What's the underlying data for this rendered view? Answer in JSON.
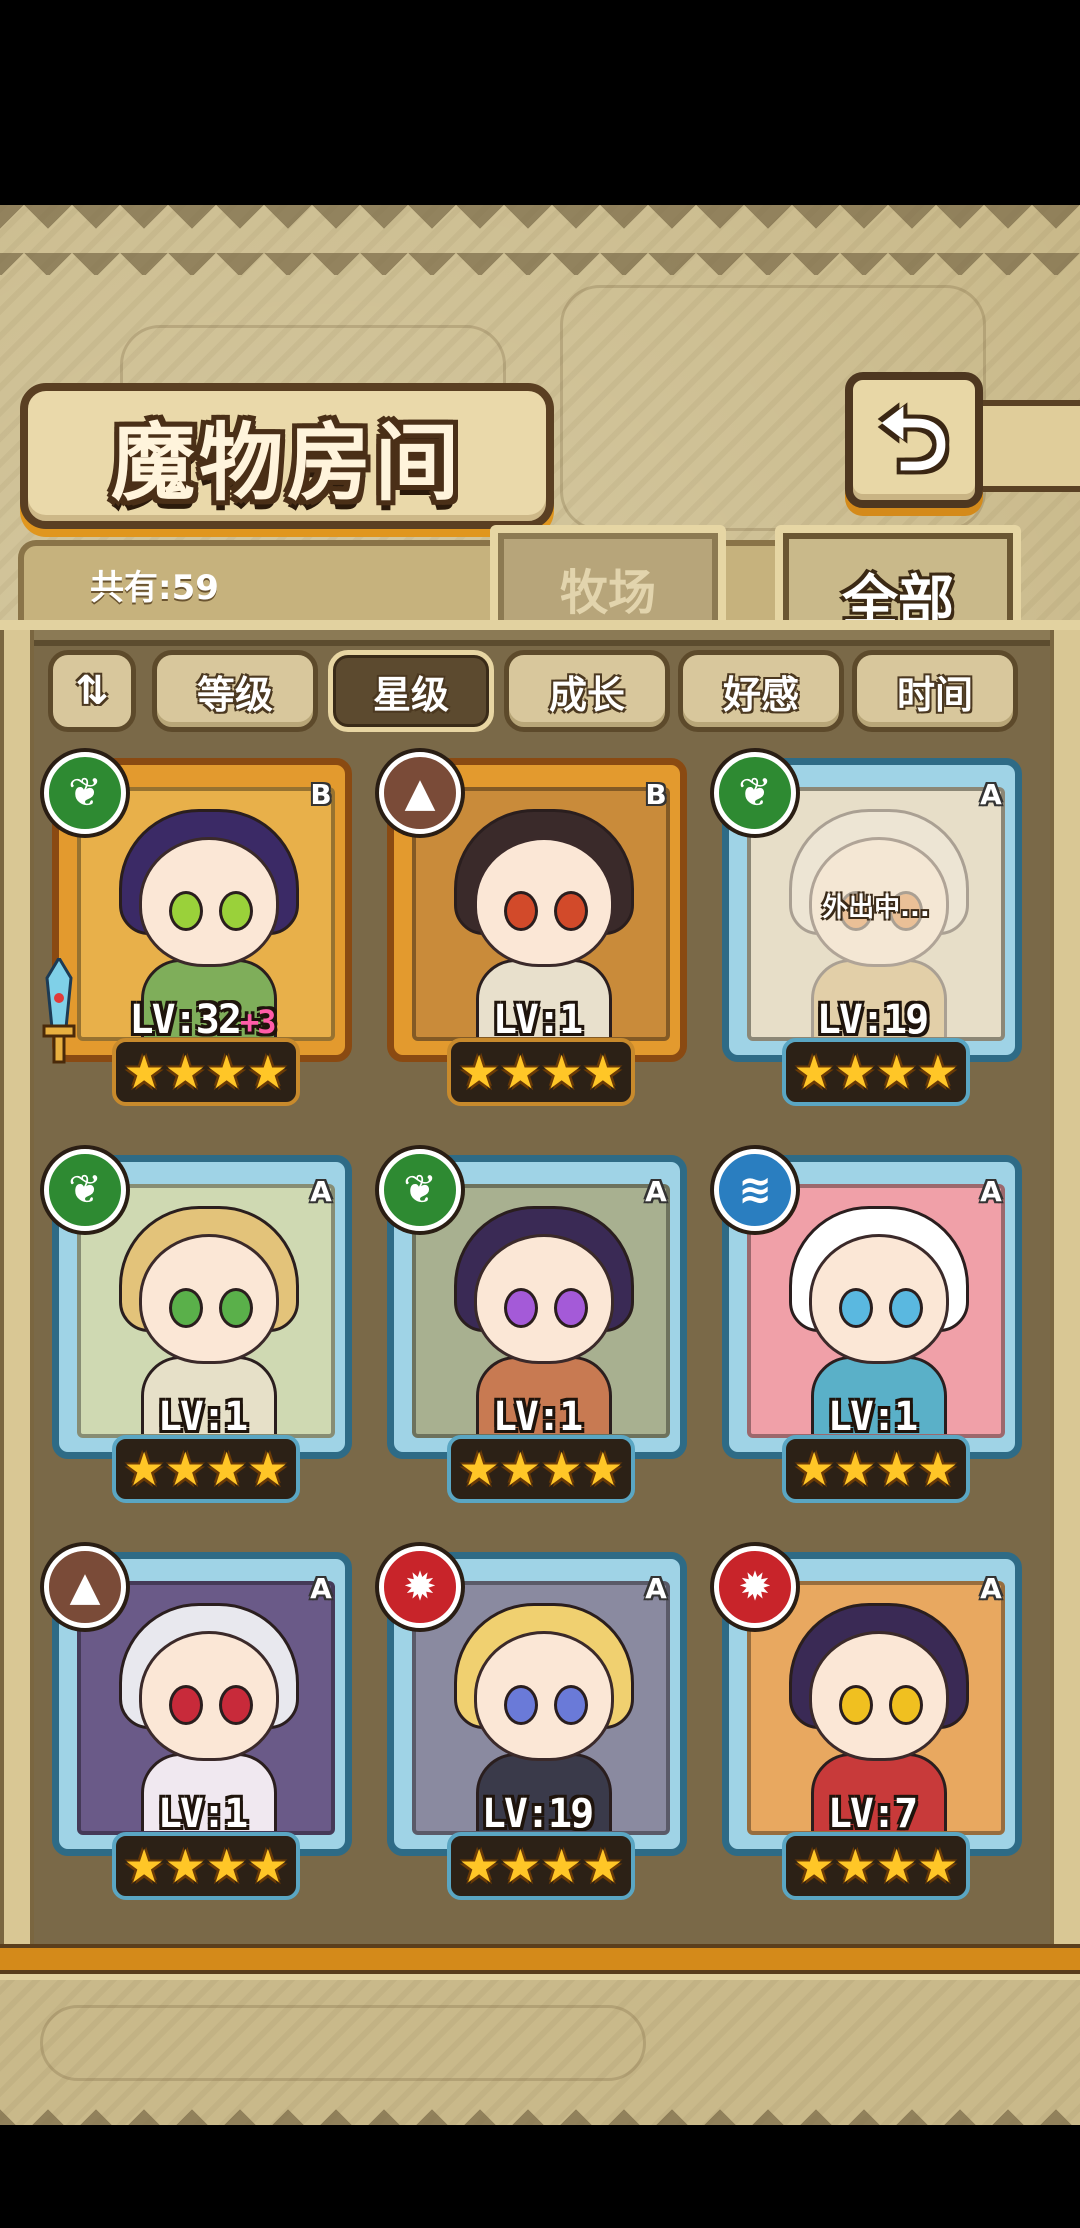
{
  "header": {
    "title": "魔物房间",
    "back_label": "⮌"
  },
  "summary": {
    "count_text": "共有:59"
  },
  "tabs": [
    {
      "label": "牧场",
      "selected": false
    },
    {
      "label": "全部",
      "selected": true
    }
  ],
  "sort": {
    "toggle_label": "⇅",
    "options": [
      {
        "label": "等级",
        "active": false
      },
      {
        "label": "星级",
        "active": true
      },
      {
        "label": "成长",
        "active": false
      },
      {
        "label": "好感",
        "active": false
      },
      {
        "label": "时间",
        "active": false
      }
    ]
  },
  "monsters": [
    {
      "rank": "B",
      "element": "leaf",
      "level": "LV:32",
      "bonus": "+3",
      "stars": 4,
      "status": "",
      "colors": {
        "hair": "#3b2a66",
        "bg": "#e8b04a",
        "body": "#7fae5a",
        "eye": "#9ad13a"
      }
    },
    {
      "rank": "B",
      "element": "rock",
      "level": "LV:1",
      "bonus": "",
      "stars": 4,
      "status": "",
      "colors": {
        "hair": "#3a2a2a",
        "bg": "#c98b3a",
        "body": "#e8e0cc",
        "eye": "#d24a2a"
      }
    },
    {
      "rank": "A",
      "element": "leaf",
      "level": "LV:19",
      "bonus": "",
      "stars": 4,
      "status": "外出中...",
      "colors": {
        "hair": "#e8e2d6",
        "bg": "#d8cfb6",
        "body": "#c9a45a",
        "eye": "#e07a2a"
      }
    },
    {
      "rank": "A",
      "element": "leaf",
      "level": "LV:1",
      "bonus": "",
      "stars": 4,
      "status": "",
      "colors": {
        "hair": "#e3c37a",
        "bg": "#cfd9b2",
        "body": "#e6e0c8",
        "eye": "#5ab04a"
      }
    },
    {
      "rank": "A",
      "element": "leaf",
      "level": "LV:1",
      "bonus": "",
      "stars": 4,
      "status": "",
      "colors": {
        "hair": "#3a2a55",
        "bg": "#a8b090",
        "body": "#c87a52",
        "eye": "#a45ad8"
      }
    },
    {
      "rank": "A",
      "element": "water",
      "level": "LV:1",
      "bonus": "",
      "stars": 4,
      "status": "",
      "colors": {
        "hair": "#ffffff",
        "bg": "#f0a0a8",
        "body": "#5ab0c8",
        "eye": "#5ab8e0"
      }
    },
    {
      "rank": "A",
      "element": "rock",
      "level": "LV:1",
      "bonus": "",
      "stars": 4,
      "status": "",
      "colors": {
        "hair": "#e8e8ee",
        "bg": "#6a5a88",
        "body": "#f0e8f0",
        "eye": "#c82a3a"
      }
    },
    {
      "rank": "A",
      "element": "fire",
      "level": "LV:19",
      "bonus": "",
      "stars": 4,
      "status": "",
      "colors": {
        "hair": "#f0d070",
        "bg": "#8a8aa0",
        "body": "#3a3a4a",
        "eye": "#6a7ad8"
      }
    },
    {
      "rank": "A",
      "element": "fire",
      "level": "LV:7",
      "bonus": "",
      "stars": 4,
      "status": "",
      "colors": {
        "hair": "#3a2a55",
        "bg": "#e8a860",
        "body": "#c83a3a",
        "eye": "#f0c020"
      }
    }
  ],
  "element_icons": {
    "leaf": "❦",
    "rock": "▲",
    "water": "≋",
    "fire": "✹"
  },
  "star_glyph": "★"
}
